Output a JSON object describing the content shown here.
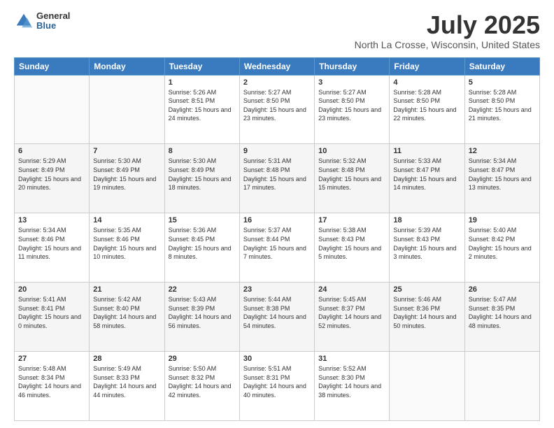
{
  "header": {
    "logo_line1": "General",
    "logo_line2": "Blue",
    "title": "July 2025",
    "subtitle": "North La Crosse, Wisconsin, United States"
  },
  "days_of_week": [
    "Sunday",
    "Monday",
    "Tuesday",
    "Wednesday",
    "Thursday",
    "Friday",
    "Saturday"
  ],
  "weeks": [
    [
      {
        "day": "",
        "sunrise": "",
        "sunset": "",
        "daylight": ""
      },
      {
        "day": "",
        "sunrise": "",
        "sunset": "",
        "daylight": ""
      },
      {
        "day": "1",
        "sunrise": "Sunrise: 5:26 AM",
        "sunset": "Sunset: 8:51 PM",
        "daylight": "Daylight: 15 hours and 24 minutes."
      },
      {
        "day": "2",
        "sunrise": "Sunrise: 5:27 AM",
        "sunset": "Sunset: 8:50 PM",
        "daylight": "Daylight: 15 hours and 23 minutes."
      },
      {
        "day": "3",
        "sunrise": "Sunrise: 5:27 AM",
        "sunset": "Sunset: 8:50 PM",
        "daylight": "Daylight: 15 hours and 23 minutes."
      },
      {
        "day": "4",
        "sunrise": "Sunrise: 5:28 AM",
        "sunset": "Sunset: 8:50 PM",
        "daylight": "Daylight: 15 hours and 22 minutes."
      },
      {
        "day": "5",
        "sunrise": "Sunrise: 5:28 AM",
        "sunset": "Sunset: 8:50 PM",
        "daylight": "Daylight: 15 hours and 21 minutes."
      }
    ],
    [
      {
        "day": "6",
        "sunrise": "Sunrise: 5:29 AM",
        "sunset": "Sunset: 8:49 PM",
        "daylight": "Daylight: 15 hours and 20 minutes."
      },
      {
        "day": "7",
        "sunrise": "Sunrise: 5:30 AM",
        "sunset": "Sunset: 8:49 PM",
        "daylight": "Daylight: 15 hours and 19 minutes."
      },
      {
        "day": "8",
        "sunrise": "Sunrise: 5:30 AM",
        "sunset": "Sunset: 8:49 PM",
        "daylight": "Daylight: 15 hours and 18 minutes."
      },
      {
        "day": "9",
        "sunrise": "Sunrise: 5:31 AM",
        "sunset": "Sunset: 8:48 PM",
        "daylight": "Daylight: 15 hours and 17 minutes."
      },
      {
        "day": "10",
        "sunrise": "Sunrise: 5:32 AM",
        "sunset": "Sunset: 8:48 PM",
        "daylight": "Daylight: 15 hours and 15 minutes."
      },
      {
        "day": "11",
        "sunrise": "Sunrise: 5:33 AM",
        "sunset": "Sunset: 8:47 PM",
        "daylight": "Daylight: 15 hours and 14 minutes."
      },
      {
        "day": "12",
        "sunrise": "Sunrise: 5:34 AM",
        "sunset": "Sunset: 8:47 PM",
        "daylight": "Daylight: 15 hours and 13 minutes."
      }
    ],
    [
      {
        "day": "13",
        "sunrise": "Sunrise: 5:34 AM",
        "sunset": "Sunset: 8:46 PM",
        "daylight": "Daylight: 15 hours and 11 minutes."
      },
      {
        "day": "14",
        "sunrise": "Sunrise: 5:35 AM",
        "sunset": "Sunset: 8:46 PM",
        "daylight": "Daylight: 15 hours and 10 minutes."
      },
      {
        "day": "15",
        "sunrise": "Sunrise: 5:36 AM",
        "sunset": "Sunset: 8:45 PM",
        "daylight": "Daylight: 15 hours and 8 minutes."
      },
      {
        "day": "16",
        "sunrise": "Sunrise: 5:37 AM",
        "sunset": "Sunset: 8:44 PM",
        "daylight": "Daylight: 15 hours and 7 minutes."
      },
      {
        "day": "17",
        "sunrise": "Sunrise: 5:38 AM",
        "sunset": "Sunset: 8:43 PM",
        "daylight": "Daylight: 15 hours and 5 minutes."
      },
      {
        "day": "18",
        "sunrise": "Sunrise: 5:39 AM",
        "sunset": "Sunset: 8:43 PM",
        "daylight": "Daylight: 15 hours and 3 minutes."
      },
      {
        "day": "19",
        "sunrise": "Sunrise: 5:40 AM",
        "sunset": "Sunset: 8:42 PM",
        "daylight": "Daylight: 15 hours and 2 minutes."
      }
    ],
    [
      {
        "day": "20",
        "sunrise": "Sunrise: 5:41 AM",
        "sunset": "Sunset: 8:41 PM",
        "daylight": "Daylight: 15 hours and 0 minutes."
      },
      {
        "day": "21",
        "sunrise": "Sunrise: 5:42 AM",
        "sunset": "Sunset: 8:40 PM",
        "daylight": "Daylight: 14 hours and 58 minutes."
      },
      {
        "day": "22",
        "sunrise": "Sunrise: 5:43 AM",
        "sunset": "Sunset: 8:39 PM",
        "daylight": "Daylight: 14 hours and 56 minutes."
      },
      {
        "day": "23",
        "sunrise": "Sunrise: 5:44 AM",
        "sunset": "Sunset: 8:38 PM",
        "daylight": "Daylight: 14 hours and 54 minutes."
      },
      {
        "day": "24",
        "sunrise": "Sunrise: 5:45 AM",
        "sunset": "Sunset: 8:37 PM",
        "daylight": "Daylight: 14 hours and 52 minutes."
      },
      {
        "day": "25",
        "sunrise": "Sunrise: 5:46 AM",
        "sunset": "Sunset: 8:36 PM",
        "daylight": "Daylight: 14 hours and 50 minutes."
      },
      {
        "day": "26",
        "sunrise": "Sunrise: 5:47 AM",
        "sunset": "Sunset: 8:35 PM",
        "daylight": "Daylight: 14 hours and 48 minutes."
      }
    ],
    [
      {
        "day": "27",
        "sunrise": "Sunrise: 5:48 AM",
        "sunset": "Sunset: 8:34 PM",
        "daylight": "Daylight: 14 hours and 46 minutes."
      },
      {
        "day": "28",
        "sunrise": "Sunrise: 5:49 AM",
        "sunset": "Sunset: 8:33 PM",
        "daylight": "Daylight: 14 hours and 44 minutes."
      },
      {
        "day": "29",
        "sunrise": "Sunrise: 5:50 AM",
        "sunset": "Sunset: 8:32 PM",
        "daylight": "Daylight: 14 hours and 42 minutes."
      },
      {
        "day": "30",
        "sunrise": "Sunrise: 5:51 AM",
        "sunset": "Sunset: 8:31 PM",
        "daylight": "Daylight: 14 hours and 40 minutes."
      },
      {
        "day": "31",
        "sunrise": "Sunrise: 5:52 AM",
        "sunset": "Sunset: 8:30 PM",
        "daylight": "Daylight: 14 hours and 38 minutes."
      },
      {
        "day": "",
        "sunrise": "",
        "sunset": "",
        "daylight": ""
      },
      {
        "day": "",
        "sunrise": "",
        "sunset": "",
        "daylight": ""
      }
    ]
  ]
}
